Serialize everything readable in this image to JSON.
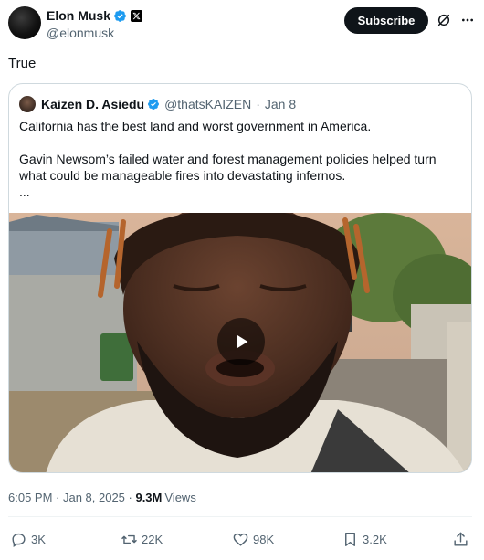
{
  "author": {
    "display_name": "Elon Musk",
    "handle": "@elonmusk"
  },
  "actions_top": {
    "subscribe_label": "Subscribe"
  },
  "tweet": {
    "text": "True"
  },
  "quote": {
    "display_name": "Kaizen D. Asiedu",
    "handle": "@thatsKAIZEN",
    "separator": "·",
    "date": "Jan 8",
    "paragraph1": "California has the best land and worst government in America.",
    "paragraph2": "Gavin Newsom’s failed water and forest management policies helped turn what could be manageable fires into devastating infernos.",
    "ellipsis": "..."
  },
  "meta": {
    "time": "6:05 PM · Jan 8, 2025 · ",
    "views_count": "9.3M",
    "views_label": "Views"
  },
  "engagement": {
    "replies": "3K",
    "reposts": "22K",
    "likes": "98K",
    "bookmarks": "3.2K"
  },
  "colors": {
    "verified": "#1d9bf0",
    "text_primary": "#0f1419",
    "text_secondary": "#536471",
    "border": "#cfd9de"
  },
  "icons": [
    "verified-badge-icon",
    "x-logo-icon",
    "grok-icon",
    "more-icon",
    "play-icon",
    "reply-icon",
    "repost-icon",
    "like-icon",
    "bookmark-icon",
    "share-icon"
  ]
}
